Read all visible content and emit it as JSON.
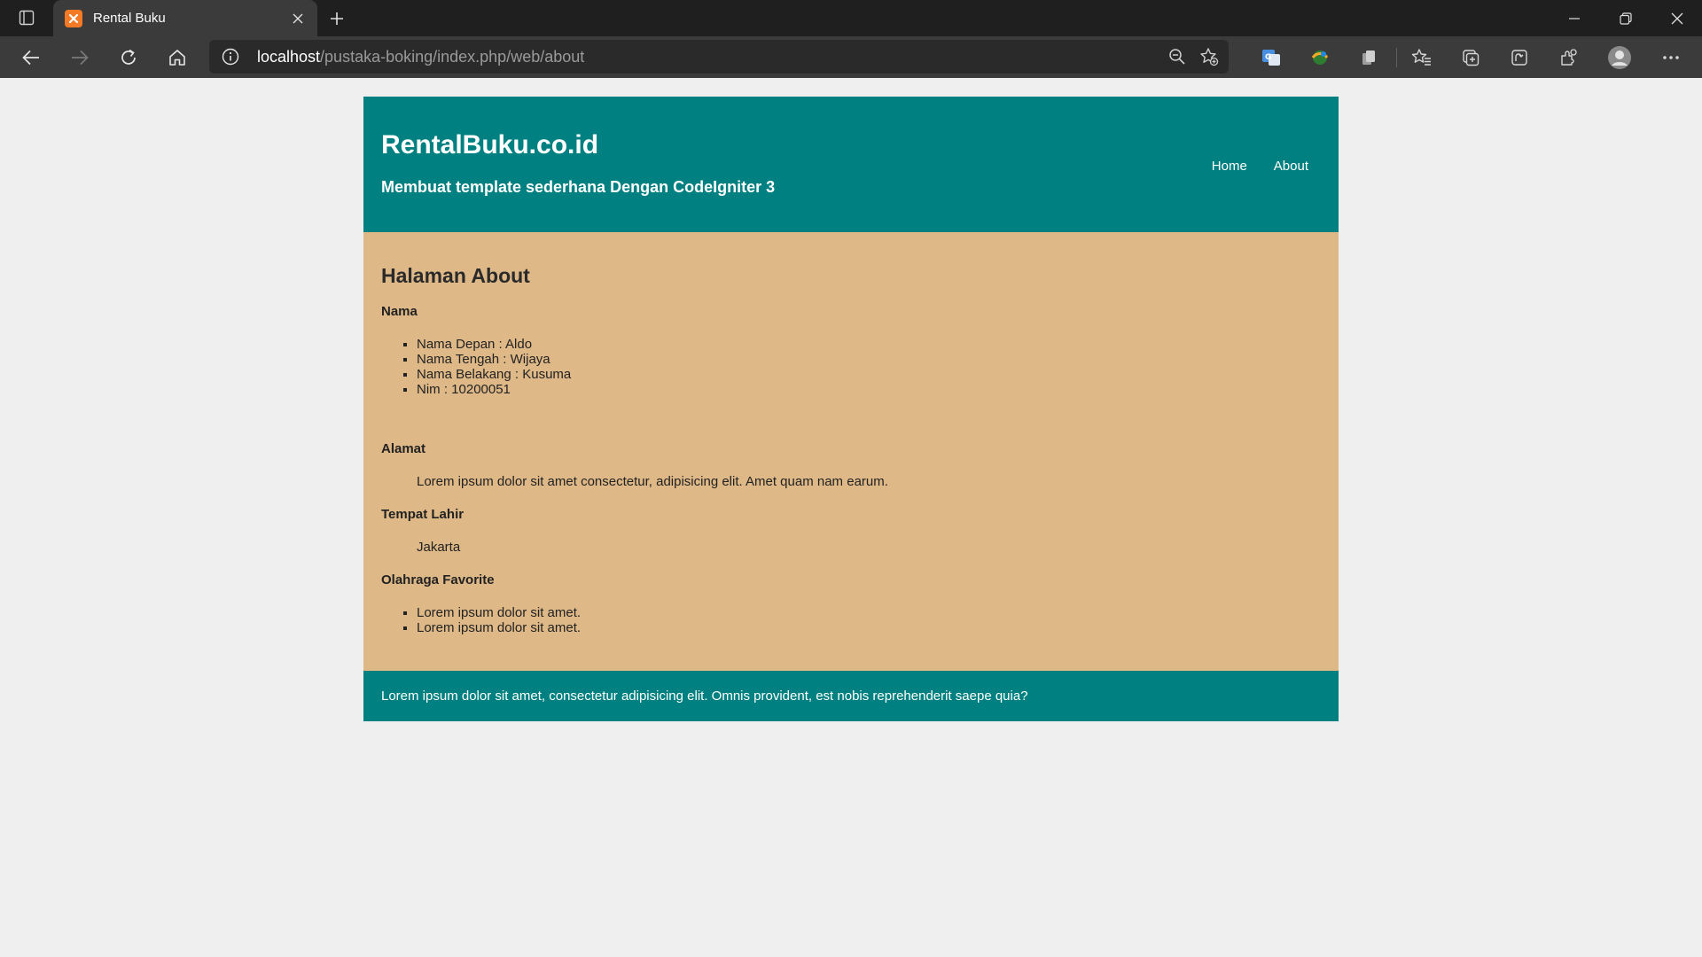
{
  "browser": {
    "tab_title": "Rental Buku",
    "url_host": "localhost",
    "url_path": "/pustaka-boking/index.php/web/about"
  },
  "site": {
    "title": "RentalBuku.co.id",
    "subtitle": "Membuat template sederhana Dengan CodeIgniter 3",
    "nav": [
      "Home",
      "About"
    ]
  },
  "content": {
    "heading": "Halaman About",
    "nama_label": "Nama",
    "nama_items": [
      "Nama Depan : Aldo",
      "Nama Tengah : Wijaya",
      "Nama Belakang : Kusuma",
      "Nim : 10200051"
    ],
    "alamat_label": "Alamat",
    "alamat_value": "Lorem ipsum dolor sit amet consectetur, adipisicing elit. Amet quam nam earum.",
    "tempat_lahir_label": "Tempat Lahir",
    "tempat_lahir_value": "Jakarta",
    "olahraga_label": "Olahraga Favorite",
    "olahraga_items": [
      "Lorem ipsum dolor sit amet.",
      "Lorem ipsum dolor sit amet."
    ]
  },
  "footer": {
    "text": "Lorem ipsum dolor sit amet, consectetur adipisicing elit. Omnis provident, est nobis reprehenderit saepe quia?"
  },
  "colors": {
    "header": "#018081",
    "content": "#deb887",
    "page_bg": "#efefef"
  }
}
